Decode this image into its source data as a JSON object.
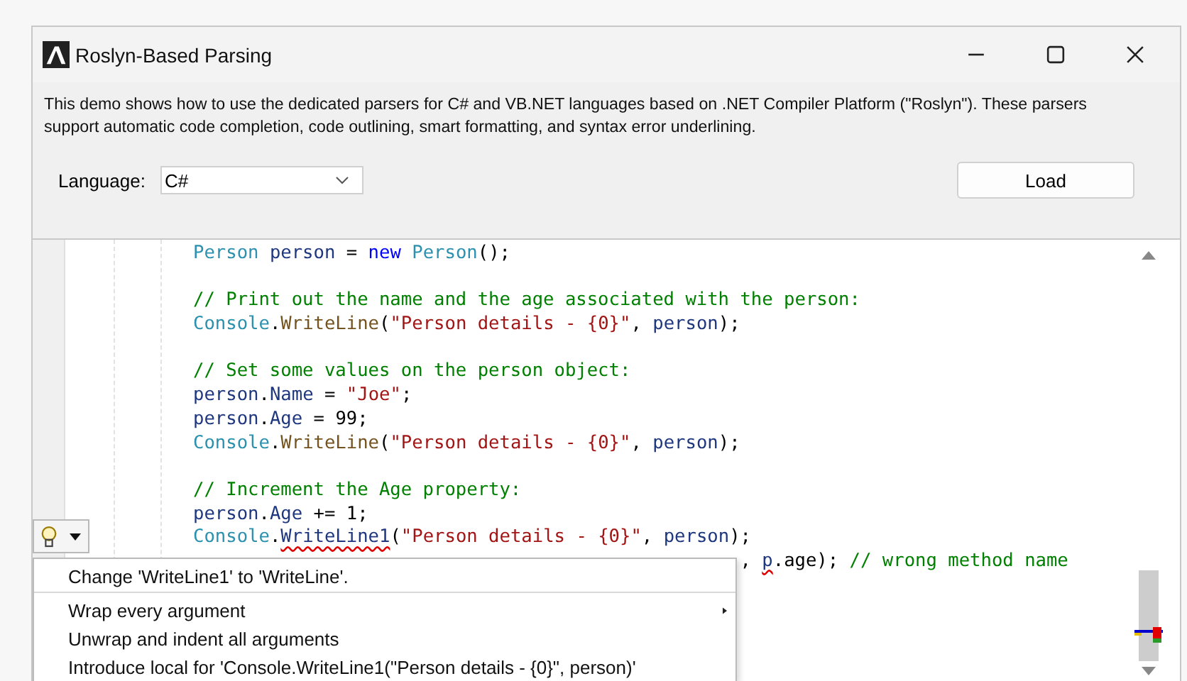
{
  "window": {
    "title": "Roslyn-Based Parsing"
  },
  "description": "This demo shows how to use the dedicated parsers for C# and VB.NET languages based on .NET Compiler Platform (\"Roslyn\"). These parsers support automatic code completion, code outlining, smart formatting, and syntax error underlining.",
  "language": {
    "label": "Language:",
    "value": "C#"
  },
  "load_button": "Load",
  "editor": {
    "lines": [
      {
        "gap_before": false,
        "tokens": [
          {
            "kind": "type",
            "text": "Person"
          },
          {
            "kind": "ident",
            "text": " person"
          },
          {
            "kind": "plain",
            "text": " = "
          },
          {
            "kind": "keyword",
            "text": "new"
          },
          {
            "kind": "type",
            "text": " Person"
          },
          {
            "kind": "plain",
            "text": "();"
          }
        ]
      },
      {
        "gap_before": true,
        "tokens": [
          {
            "kind": "comment",
            "text": "// Print out the name and the age associated with the person:"
          }
        ]
      },
      {
        "gap_before": false,
        "tokens": [
          {
            "kind": "type",
            "text": "Console"
          },
          {
            "kind": "plain",
            "text": "."
          },
          {
            "kind": "method",
            "text": "WriteLine"
          },
          {
            "kind": "plain",
            "text": "("
          },
          {
            "kind": "string",
            "text": "\"Person details - {0}\""
          },
          {
            "kind": "plain",
            "text": ", "
          },
          {
            "kind": "ident",
            "text": "person"
          },
          {
            "kind": "plain",
            "text": ");"
          }
        ]
      },
      {
        "gap_before": true,
        "tokens": [
          {
            "kind": "comment",
            "text": "// Set some values on the person object:"
          }
        ]
      },
      {
        "gap_before": false,
        "tokens": [
          {
            "kind": "ident",
            "text": "person"
          },
          {
            "kind": "plain",
            "text": "."
          },
          {
            "kind": "ident",
            "text": "Name"
          },
          {
            "kind": "plain",
            "text": " = "
          },
          {
            "kind": "string",
            "text": "\"Joe\""
          },
          {
            "kind": "plain",
            "text": ";"
          }
        ]
      },
      {
        "gap_before": false,
        "tokens": [
          {
            "kind": "ident",
            "text": "person"
          },
          {
            "kind": "plain",
            "text": "."
          },
          {
            "kind": "ident",
            "text": "Age"
          },
          {
            "kind": "plain",
            "text": " = 99;"
          }
        ]
      },
      {
        "gap_before": false,
        "tokens": [
          {
            "kind": "type",
            "text": "Console"
          },
          {
            "kind": "plain",
            "text": "."
          },
          {
            "kind": "method",
            "text": "WriteLine"
          },
          {
            "kind": "plain",
            "text": "("
          },
          {
            "kind": "string",
            "text": "\"Person details - {0}\""
          },
          {
            "kind": "plain",
            "text": ", "
          },
          {
            "kind": "ident",
            "text": "person"
          },
          {
            "kind": "plain",
            "text": ");"
          }
        ]
      },
      {
        "gap_before": true,
        "tokens": [
          {
            "kind": "comment",
            "text": "// Increment the Age property:"
          }
        ]
      },
      {
        "gap_before": false,
        "tokens": [
          {
            "kind": "ident",
            "text": "person"
          },
          {
            "kind": "plain",
            "text": "."
          },
          {
            "kind": "ident",
            "text": "Age"
          },
          {
            "kind": "plain",
            "text": " += 1;"
          }
        ]
      },
      {
        "gap_before": false,
        "tokens": [
          {
            "kind": "type",
            "text": "Console"
          },
          {
            "kind": "plain",
            "text": "."
          },
          {
            "kind": "ident",
            "text": "WriteLine1",
            "error": true
          },
          {
            "kind": "plain",
            "text": "("
          },
          {
            "kind": "string",
            "text": "\"Person details - {0}\""
          },
          {
            "kind": "plain",
            "text": ", "
          },
          {
            "kind": "ident",
            "text": "person"
          },
          {
            "kind": "plain",
            "text": ");"
          }
        ]
      },
      {
        "gap_before": false,
        "tokens": [
          {
            "kind": "plain",
            "text": "                                                  , "
          },
          {
            "kind": "ident",
            "text": "p",
            "error": true
          },
          {
            "kind": "plain",
            "text": ".age); "
          },
          {
            "kind": "comment",
            "text": "// wrong method name"
          }
        ]
      }
    ]
  },
  "quick_fix_menu": {
    "items": [
      {
        "label": "Change 'WriteLine1' to 'WriteLine'.",
        "has_submenu": false,
        "divider_after": true
      },
      {
        "label": "Wrap every argument",
        "has_submenu": true,
        "divider_after": false
      },
      {
        "label": "Unwrap and indent all arguments",
        "has_submenu": false,
        "divider_after": false
      },
      {
        "label": "Introduce local for 'Console.WriteLine1(\"Person details - {0}\", person)'",
        "has_submenu": false,
        "divider_after": false
      }
    ]
  }
}
